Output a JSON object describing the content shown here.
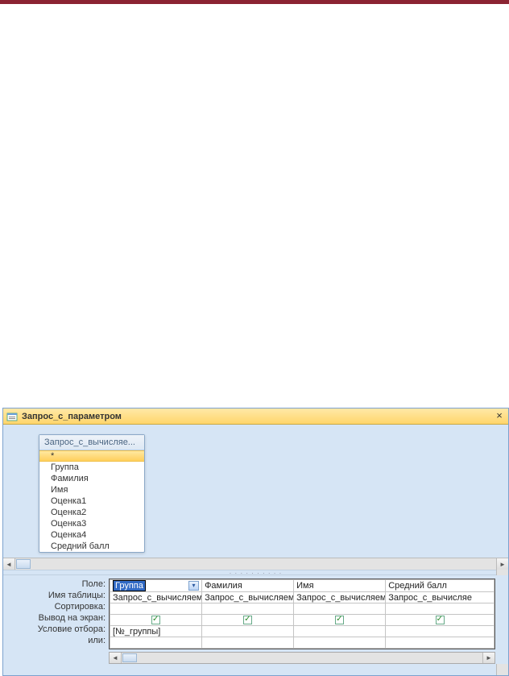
{
  "window": {
    "title": "Запрос_с_параметром"
  },
  "source_table": {
    "header": "Запрос_с_вычисляе...",
    "fields": [
      "*",
      "Группа",
      "Фамилия",
      "Имя",
      "Оценка1",
      "Оценка2",
      "Оценка3",
      "Оценка4",
      "Средний балл"
    ],
    "selected_index": 0
  },
  "grid_labels": {
    "field": "Поле:",
    "table": "Имя таблицы:",
    "sort": "Сортировка:",
    "show": "Вывод на экран:",
    "criteria": "Условие отбора:",
    "or": "или:"
  },
  "columns": [
    {
      "field": "Группа",
      "table": "Запрос_с_вычисляем",
      "sort": "",
      "show": true,
      "criteria": "[№_группы]",
      "field_active": true
    },
    {
      "field": "Фамилия",
      "table": "Запрос_с_вычисляем",
      "sort": "",
      "show": true,
      "criteria": "",
      "field_active": false
    },
    {
      "field": "Имя",
      "table": "Запрос_с_вычисляем",
      "sort": "",
      "show": true,
      "criteria": "",
      "field_active": false
    },
    {
      "field": "Средний балл",
      "table": "Запрос_с_вычисляе",
      "sort": "",
      "show": true,
      "criteria": "",
      "field_active": false
    }
  ]
}
